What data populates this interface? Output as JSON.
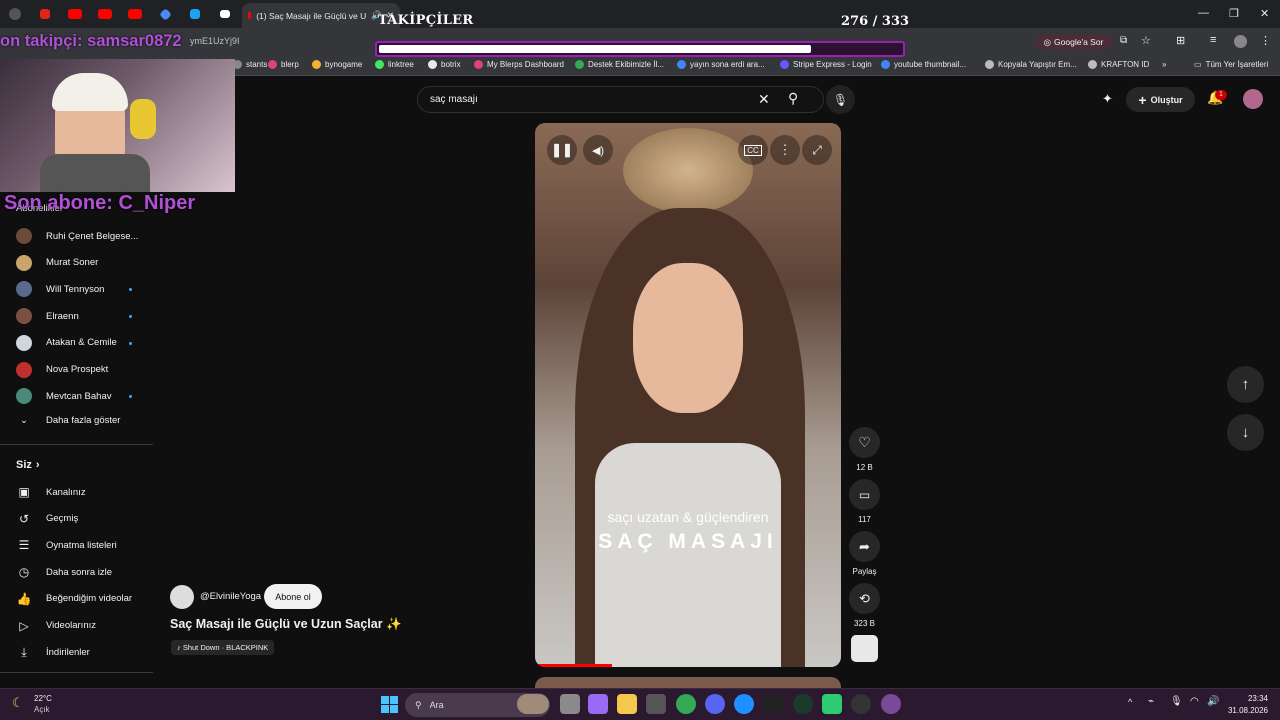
{
  "browser": {
    "active_tab_title": "(1) Saç Masajı ile Güçlü ve U",
    "url_fragment": "ymE1UzYj9I",
    "google_sor_label": "Google'a Sor",
    "bookmarks": [
      {
        "label": "stants",
        "color": "#888"
      },
      {
        "label": "blerp",
        "color": "#e0407b"
      },
      {
        "label": "bynogame",
        "color": "#f2b233"
      },
      {
        "label": "linktree",
        "color": "#43e660"
      },
      {
        "label": "botrix",
        "color": "#e8eaed"
      },
      {
        "label": "My Blerps Dashboard",
        "color": "#e0407b"
      },
      {
        "label": "Destek Ekibimizle İl...",
        "color": "#34a853"
      },
      {
        "label": "yayın sona erdi ara...",
        "color": "#4285f4"
      },
      {
        "label": "Stripe Express - Login",
        "color": "#635bff"
      },
      {
        "label": "youtube thumbnail...",
        "color": "#4285f4"
      },
      {
        "label": "Kopyala Yapıştır Em...",
        "color": "#bbb"
      },
      {
        "label": "KRAFTON ID",
        "color": "#bbb"
      }
    ],
    "all_bookmarks_label": "Tüm Yer İşaretleri"
  },
  "overlay": {
    "followers_title": "TAKİPÇİLER",
    "followers_count": "276 / 333",
    "followers_progress": 0.829,
    "last_follower": "on takipçi: samsar0872",
    "last_subscriber": "Son abone: C_Niper"
  },
  "youtube": {
    "search_value": "saç masajı",
    "create_label": "Oluştur",
    "notification_count": "1",
    "subscriptions_header": "Abonelikler",
    "subscriptions": [
      {
        "name": "Ruhi Çenet Belgese...",
        "avatar": "#6b4a3a",
        "new": false
      },
      {
        "name": "Murat Soner",
        "avatar": "#c9a56b",
        "new": false
      },
      {
        "name": "Will Tennyson",
        "avatar": "#5a6a8a",
        "new": true
      },
      {
        "name": "Elraenn",
        "avatar": "#7a5044",
        "new": true
      },
      {
        "name": "Atakan & Cemile",
        "avatar": "#d0d6de",
        "new": true
      },
      {
        "name": "Nova Prospekt",
        "avatar": "#c0302e",
        "new": false
      },
      {
        "name": "Mevtcan Bahav",
        "avatar": "#4a8a7a",
        "new": true
      }
    ],
    "show_more": "Daha fazla göster",
    "you_header": "Siz",
    "you_items": [
      {
        "label": "Kanalınız",
        "icon": "account-box-icon"
      },
      {
        "label": "Geçmiş",
        "icon": "history-icon"
      },
      {
        "label": "Oynatma listeleri",
        "icon": "playlist-icon"
      },
      {
        "label": "Daha sonra izle",
        "icon": "clock-icon"
      },
      {
        "label": "Beğendiğim videolar",
        "icon": "thumbs-up-icon"
      },
      {
        "label": "Videolarınız",
        "icon": "video-icon"
      },
      {
        "label": "İndirilenler",
        "icon": "download-icon"
      }
    ],
    "short": {
      "channel": "@ElvinileYoga",
      "subscribe": "Abone ol",
      "title": "Saç Masajı ile Güçlü ve Uzun Saçlar ✨",
      "music": "♪ Shut Down · BLACKPINK",
      "caption_small": "saçı uzatan & güçlendiren",
      "caption_big": "SAÇ MASAJI",
      "likes": "12 B",
      "comments": "117",
      "share": "Paylaş",
      "remix": "323 B",
      "progress": 0.25
    }
  },
  "taskbar": {
    "weather_temp": "22°C",
    "weather_text": "Açık",
    "search_placeholder": "Ara",
    "time": "23:34",
    "date": "31.08.2026"
  }
}
